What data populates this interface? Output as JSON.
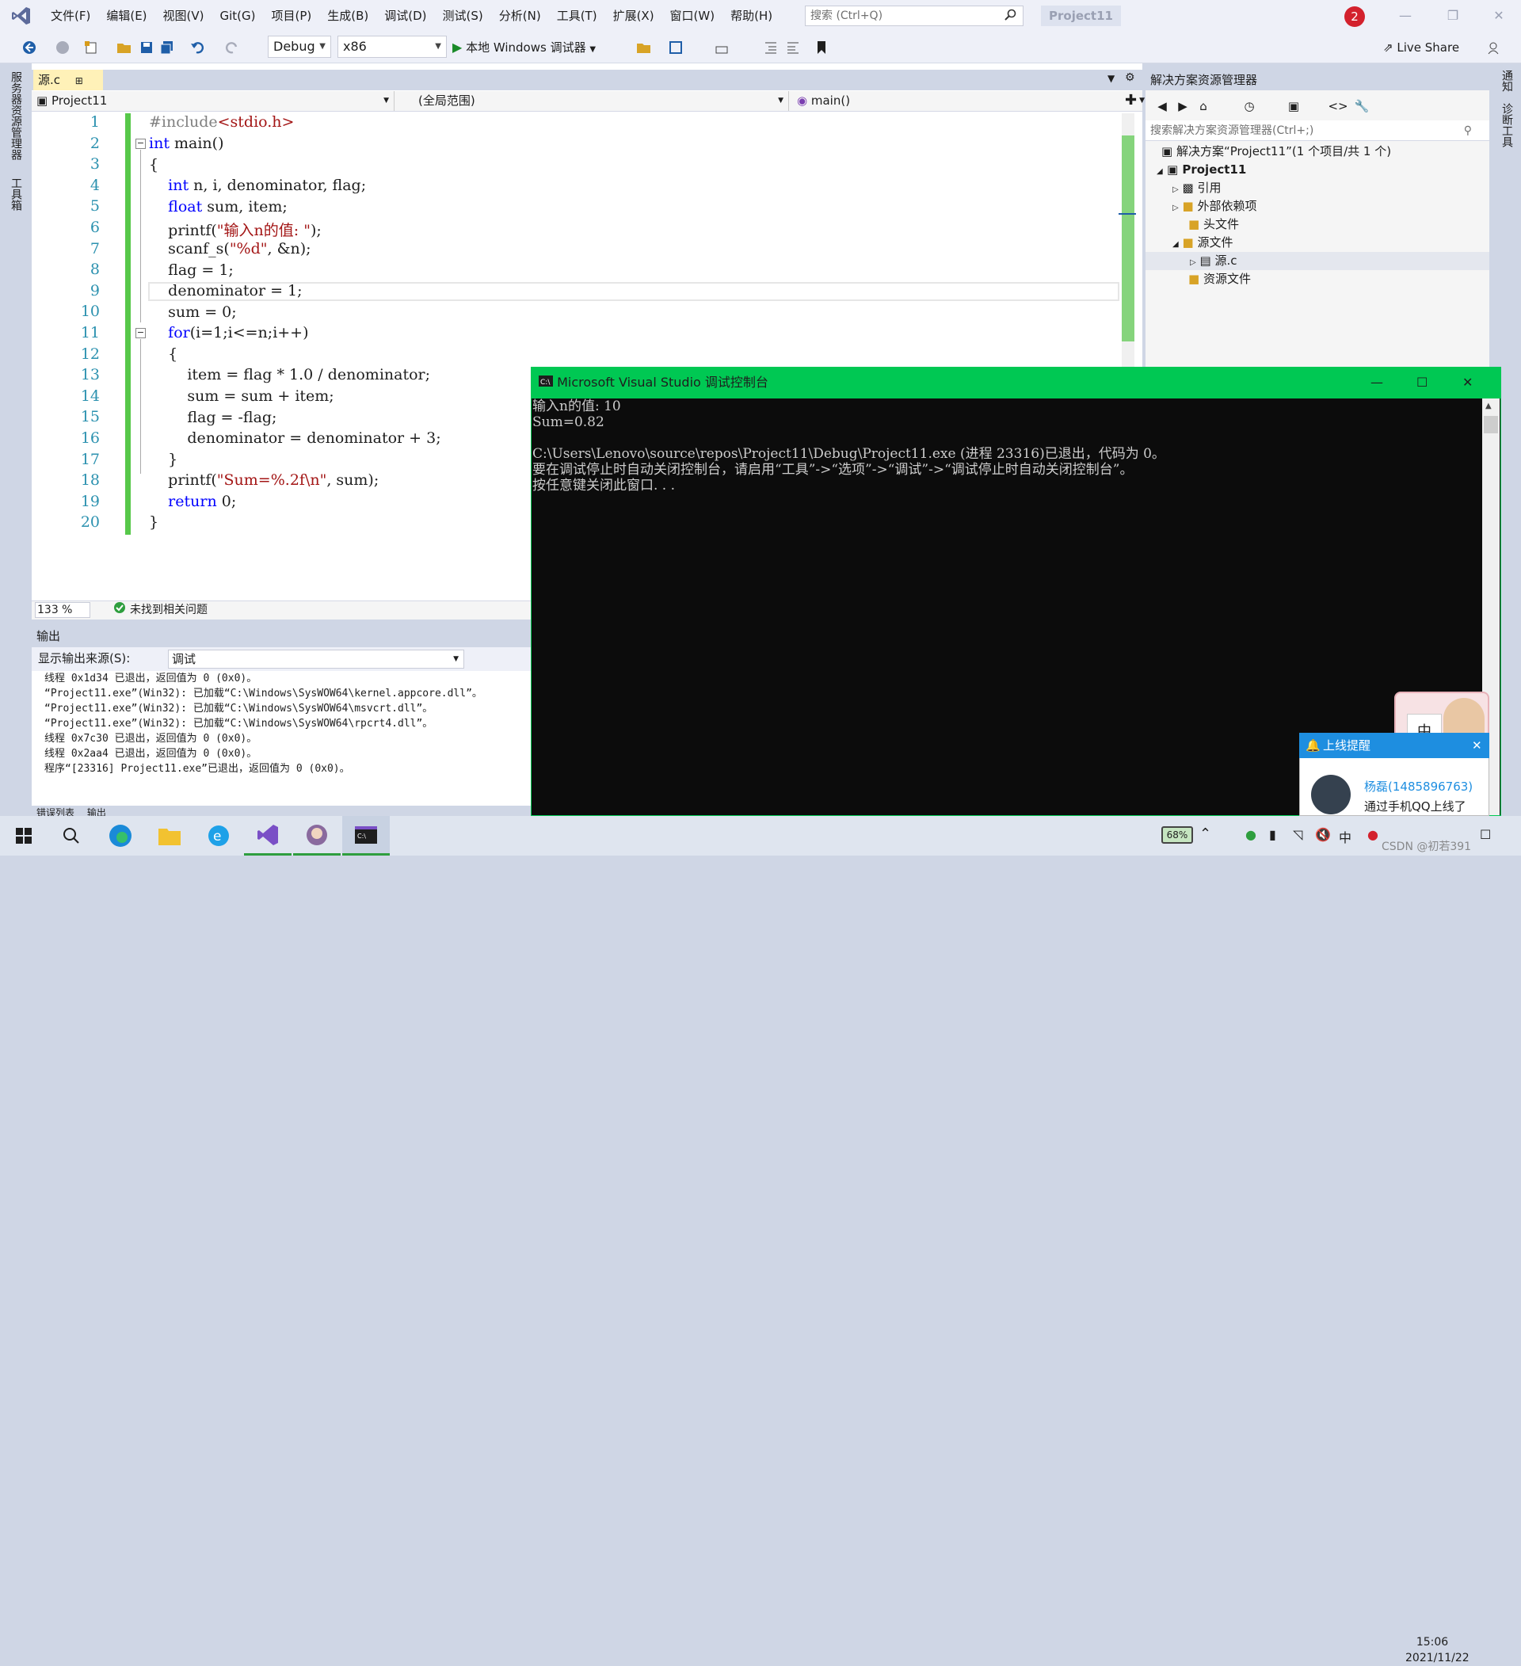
{
  "menubar": {
    "items": [
      "文件(F)",
      "编辑(E)",
      "视图(V)",
      "Git(G)",
      "项目(P)",
      "生成(B)",
      "调试(D)",
      "测试(S)",
      "分析(N)",
      "工具(T)",
      "扩展(X)",
      "窗口(W)",
      "帮助(H)"
    ],
    "search_placeholder": "搜索 (Ctrl+Q)",
    "project_name": "Project11",
    "notification_count": "2"
  },
  "toolbar": {
    "config": "Debug",
    "platform": "x86",
    "run_label": "本地 Windows 调试器",
    "live_share": "Live Share"
  },
  "left_strip": {
    "server_explorer": "服务器资源管理器",
    "toolbox": "工具箱"
  },
  "right_strip": {
    "notifications": "通知",
    "diagnostics": "诊断工具"
  },
  "editor": {
    "tab_name": "源.c",
    "nav_project": "Project11",
    "nav_scope": "(全局范围)",
    "nav_member": "main()",
    "line_numbers": [
      "1",
      "2",
      "3",
      "4",
      "5",
      "6",
      "7",
      "8",
      "9",
      "10",
      "11",
      "12",
      "13",
      "14",
      "15",
      "16",
      "17",
      "18",
      "19",
      "20"
    ],
    "zoom": "133 %",
    "status": "未找到相关问题"
  },
  "output": {
    "title": "输出",
    "source_label": "显示输出来源(S):",
    "source_value": "调试",
    "lines": [
      "线程 0x1d34 已退出，返回值为 0 (0x0)。",
      "“Project11.exe”(Win32): 已加载“C:\\Windows\\SysWOW64\\kernel.appcore.dll”。",
      "“Project11.exe”(Win32): 已加载“C:\\Windows\\SysWOW64\\msvcrt.dll”。",
      "“Project11.exe”(Win32): 已加载“C:\\Windows\\SysWOW64\\rpcrt4.dll”。",
      "线程 0x7c30 已退出，返回值为 0 (0x0)。",
      "线程 0x2aa4 已退出，返回值为 0 (0x0)。",
      "程序“[23316] Project11.exe”已退出，返回值为 0 (0x0)。"
    ],
    "tab_errors": "错误列表",
    "tab_output": "输出"
  },
  "solution": {
    "title": "解决方案资源管理器",
    "search_placeholder": "搜索解决方案资源管理器(Ctrl+;)",
    "root": "解决方案“Project11”(1 个项目/共 1 个)",
    "project": "Project11",
    "references": "引用",
    "external_deps": "外部依赖项",
    "headers": "头文件",
    "sources": "源文件",
    "source_file": "源.c",
    "resources": "资源文件"
  },
  "console": {
    "title": "Microsoft Visual Studio 调试控制台",
    "lines": [
      "输入n的值: 10",
      "Sum=0.82",
      "",
      "C:\\Users\\Lenovo\\source\\repos\\Project11\\Debug\\Project11.exe (进程 23316)已退出，代码为 0。",
      "要在调试停止时自动关闭控制台，请启用“工具”->“选项”->“调试”->“调试停止时自动关闭控制台”。",
      "按任意键关闭此窗口. . ."
    ]
  },
  "qq": {
    "header": "上线提醒",
    "name": "杨磊(1485896763)",
    "message": "通过手机QQ上线了",
    "widget_char": "中"
  },
  "taskbar": {
    "battery": "68%",
    "ime": "中",
    "time": "15:06",
    "date": "2021/11/22",
    "watermark": "CSDN @初若391"
  }
}
